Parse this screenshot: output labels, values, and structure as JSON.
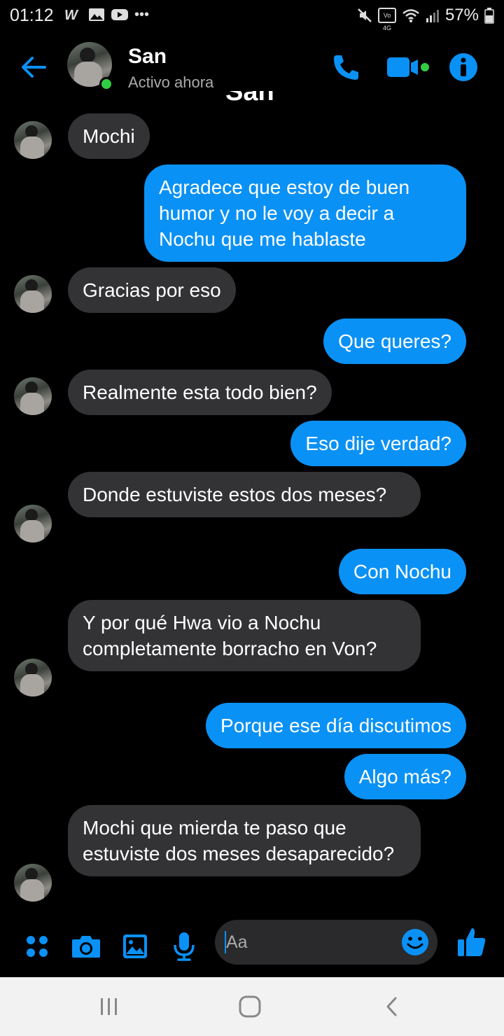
{
  "status_bar": {
    "time": "01:12",
    "left_icons": [
      "w-icon",
      "gallery-icon",
      "youtube-icon",
      "more-dots-icon"
    ],
    "right_icons": [
      "mute-icon",
      "volte-4g-icon",
      "wifi-icon",
      "signal-icon"
    ],
    "battery": "57%",
    "volte_label": "Vo 4G"
  },
  "header": {
    "contact_name": "San",
    "contact_status": "Activo ahora",
    "clipped_title": "San",
    "accent_color": "#0a91f5",
    "online_color": "#31cc46"
  },
  "messages": [
    {
      "side": "in",
      "text": "Mochi"
    },
    {
      "side": "out",
      "text": "Agradece que estoy de buen humor y no le voy a decir a Nochu que me hablaste"
    },
    {
      "side": "in",
      "text": "Gracias por eso"
    },
    {
      "side": "out",
      "text": "Que queres?"
    },
    {
      "side": "in",
      "text": "Realmente esta todo bien?"
    },
    {
      "side": "out",
      "text": "Eso dije verdad?"
    },
    {
      "side": "in",
      "text": "Donde estuviste estos dos meses?"
    },
    {
      "side": "out",
      "text": "Con Nochu"
    },
    {
      "side": "in",
      "text": "Y por qué Hwa vio a Nochu completamente borracho en Von?"
    },
    {
      "side": "out",
      "text": "Porque ese día discutimos"
    },
    {
      "side": "out",
      "text": "Algo más?"
    },
    {
      "side": "in",
      "text": "Mochi que mierda te paso que estuviste dos meses desaparecido?"
    }
  ],
  "composer": {
    "placeholder": "Aa",
    "icons": [
      "apps-icon",
      "camera-icon",
      "image-icon",
      "microphone-icon",
      "emoji-icon",
      "like-icon"
    ]
  },
  "navbar": {
    "icons": [
      "recents-icon",
      "home-icon",
      "back-icon"
    ]
  }
}
